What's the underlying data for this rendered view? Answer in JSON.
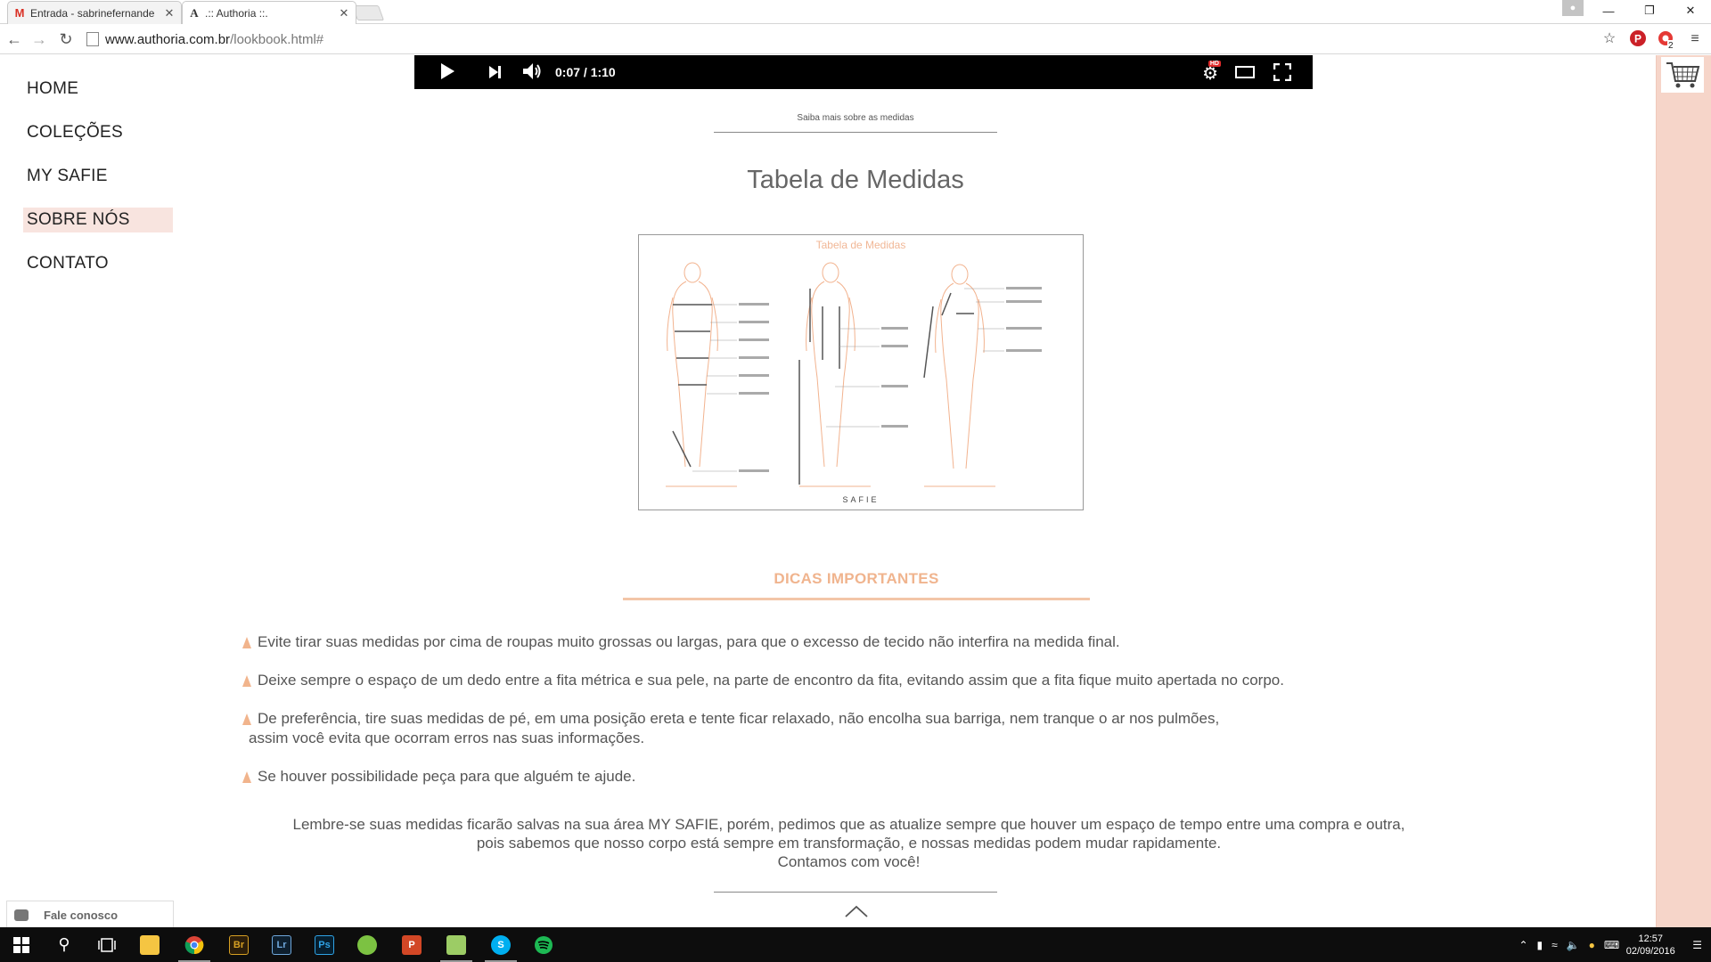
{
  "browser": {
    "tabs": [
      {
        "title": "Entrada - sabrinefernande",
        "favicon": "gmail-icon",
        "active": false
      },
      {
        "title": ".:: Authoria ::.",
        "favicon": "A",
        "active": true
      }
    ],
    "url_host": "www.authoria.com.br",
    "url_path": "/lookbook.html#",
    "extension_badge": "2"
  },
  "nav": {
    "items": [
      {
        "label": "HOME",
        "active": false
      },
      {
        "label": "COLEÇÕES",
        "active": false
      },
      {
        "label": "MY SAFIE",
        "active": false
      },
      {
        "label": "SOBRE NÓS",
        "active": true
      },
      {
        "label": "CONTATO",
        "active": false
      }
    ]
  },
  "video": {
    "time": "0:07 / 1:10",
    "hd_badge": "HD"
  },
  "content": {
    "saiba_link": "Saiba mais sobre as medidas",
    "table_title": "Tabela de Medidas",
    "image_title": "Tabela de Medidas",
    "image_brand": "SAFIE",
    "dicas_title": "DICAS IMPORTANTES",
    "tips": [
      {
        "line1": "Evite tirar suas medidas por cima de roupas muito grossas ou largas, para que o excesso de tecido não interfira na medida final.",
        "line2": ""
      },
      {
        "line1": "Deixe sempre o espaço de um dedo entre a fita métrica e sua pele, na parte de encontro da fita, evitando assim que a fita fique muito apertada no corpo.",
        "line2": ""
      },
      {
        "line1": "De preferência, tire suas medidas de pé, em uma posição ereta e tente ficar relaxado, não encolha sua barriga, nem tranque o ar nos pulmões,",
        "line2": "assim você evita que ocorram erros nas suas informações."
      },
      {
        "line1": "Se houver possibilidade peça para que alguém te ajude.",
        "line2": ""
      }
    ],
    "closing": {
      "line1": "Lembre-se suas medidas ficarão salvas na sua área MY SAFIE, porém, pedimos que as atualize sempre que houver um espaço de tempo entre uma compra e outra,",
      "line2": "pois sabemos que nosso corpo está sempre em transformação, e nossas medidas podem mudar rapidamente.",
      "line3": "Contamos com você!"
    }
  },
  "chat": {
    "label": "Fale conosco"
  },
  "taskbar": {
    "apps": [
      {
        "name": "file-explorer",
        "label": "",
        "color": "#f5c542"
      },
      {
        "name": "chrome",
        "label": "",
        "color": "#4caf50"
      },
      {
        "name": "bridge",
        "label": "Br",
        "color": "#d7a023"
      },
      {
        "name": "lightroom",
        "label": "Lr",
        "color": "#3a6b9c"
      },
      {
        "name": "photoshop",
        "label": "Ps",
        "color": "#2fa3e6"
      },
      {
        "name": "corel",
        "label": "",
        "color": "#7cc242"
      },
      {
        "name": "powerpoint",
        "label": "P",
        "color": "#d24726"
      },
      {
        "name": "folder",
        "label": "",
        "color": "#9ccc65"
      },
      {
        "name": "skype",
        "label": "S",
        "color": "#00aff0"
      },
      {
        "name": "spotify",
        "label": "",
        "color": "#1db954"
      }
    ],
    "clock_time": "12:57",
    "clock_date": "02/09/2016"
  }
}
